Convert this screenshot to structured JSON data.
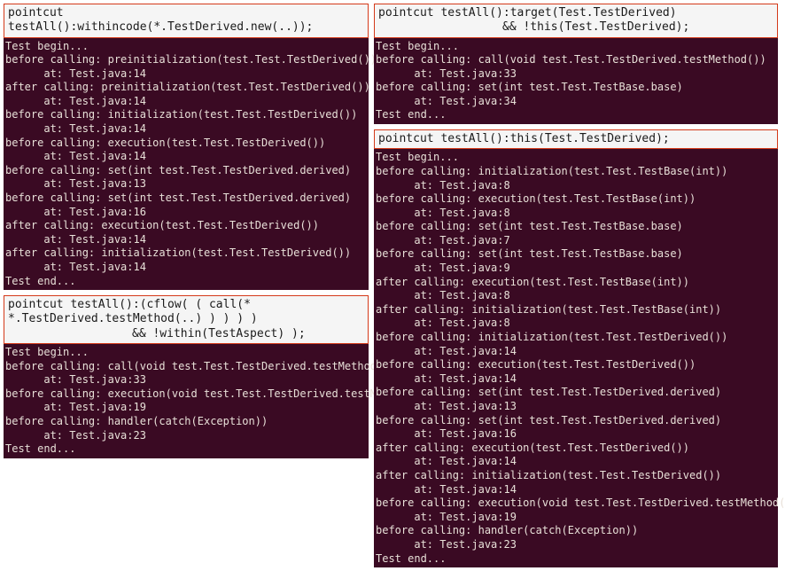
{
  "panels": {
    "topLeft": {
      "header": {
        "line1": "pointcut testAll():withincode(*.TestDerived.new(..));"
      },
      "lines": [
        "Test begin...",
        "before calling: preinitialization(test.Test.TestDerived())",
        "      at: Test.java:14",
        "after calling: preinitialization(test.Test.TestDerived())",
        "      at: Test.java:14",
        "before calling: initialization(test.Test.TestDerived())",
        "      at: Test.java:14",
        "before calling: execution(test.Test.TestDerived())",
        "      at: Test.java:14",
        "before calling: set(int test.Test.TestDerived.derived)",
        "      at: Test.java:13",
        "before calling: set(int test.Test.TestDerived.derived)",
        "      at: Test.java:16",
        "after calling: execution(test.Test.TestDerived())",
        "      at: Test.java:14",
        "after calling: initialization(test.Test.TestDerived())",
        "      at: Test.java:14",
        "Test end..."
      ]
    },
    "bottomLeft": {
      "header": {
        "line1": "pointcut testAll():(cflow( ( call(* *.TestDerived.testMethod(..) ) ) ) )",
        "line2": "&& !within(TestAspect) );"
      },
      "lines": [
        "Test begin...",
        "before calling: call(void test.Test.TestDerived.testMethod())",
        "      at: Test.java:33",
        "before calling: execution(void test.Test.TestDerived.testMethod())",
        "      at: Test.java:19",
        "before calling: handler(catch(Exception))",
        "      at: Test.java:23",
        "Test end..."
      ]
    },
    "topRight": {
      "header": {
        "line1": "pointcut testAll():target(Test.TestDerived)",
        "line2": "&& !this(Test.TestDerived);"
      },
      "lines": [
        "Test begin...",
        "before calling: call(void test.Test.TestDerived.testMethod())",
        "      at: Test.java:33",
        "before calling: set(int test.Test.TestBase.base)",
        "      at: Test.java:34",
        "Test end..."
      ]
    },
    "bottomRight": {
      "header": {
        "line1": "pointcut testAll():this(Test.TestDerived);"
      },
      "lines": [
        "Test begin...",
        "before calling: initialization(test.Test.TestBase(int))",
        "      at: Test.java:8",
        "before calling: execution(test.Test.TestBase(int))",
        "      at: Test.java:8",
        "before calling: set(int test.Test.TestBase.base)",
        "      at: Test.java:7",
        "before calling: set(int test.Test.TestBase.base)",
        "      at: Test.java:9",
        "after calling: execution(test.Test.TestBase(int))",
        "      at: Test.java:8",
        "after calling: initialization(test.Test.TestBase(int))",
        "      at: Test.java:8",
        "before calling: initialization(test.Test.TestDerived())",
        "      at: Test.java:14",
        "before calling: execution(test.Test.TestDerived())",
        "      at: Test.java:14",
        "before calling: set(int test.Test.TestDerived.derived)",
        "      at: Test.java:13",
        "before calling: set(int test.Test.TestDerived.derived)",
        "      at: Test.java:16",
        "after calling: execution(test.Test.TestDerived())",
        "      at: Test.java:14",
        "after calling: initialization(test.Test.TestDerived())",
        "      at: Test.java:14",
        "before calling: execution(void test.Test.TestDerived.testMethod())",
        "      at: Test.java:19",
        "before calling: handler(catch(Exception))",
        "      at: Test.java:23",
        "Test end..."
      ]
    }
  }
}
